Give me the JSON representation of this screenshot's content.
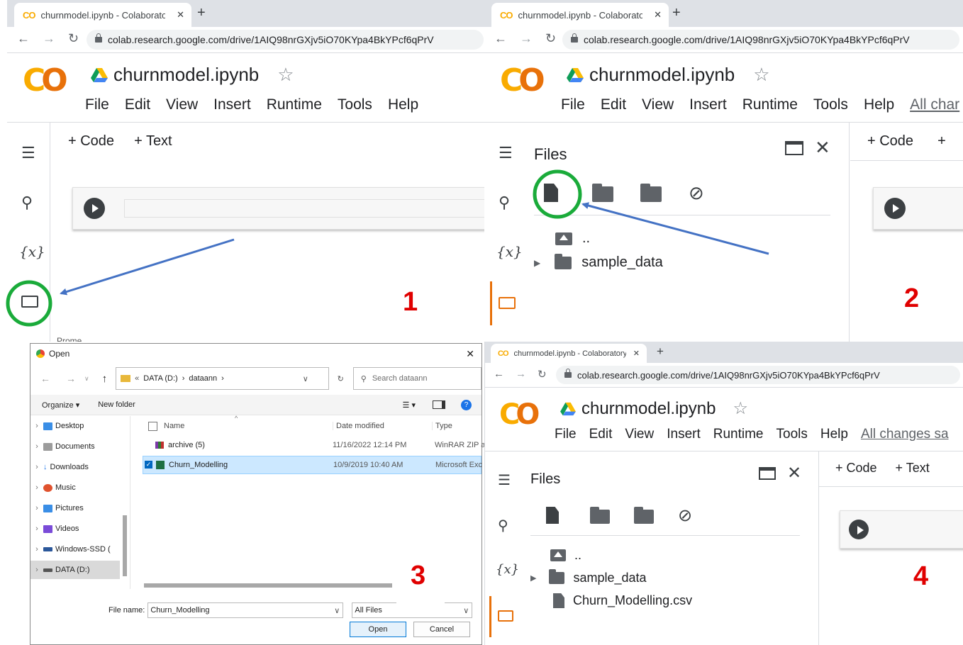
{
  "browser": {
    "tab_title": "churnmodel.ipynb - Colaboratory",
    "tab_logo": "CO",
    "tab_close": "✕",
    "new_tab": "+",
    "url": "colab.research.google.com/drive/1AIQ98nrGXjv5iO70KYpa4BkYPcf6qPrV",
    "nav_icons": [
      "back-icon",
      "forward-icon",
      "reload-icon"
    ]
  },
  "colab": {
    "logo_c": "C",
    "logo_o": "O",
    "notebook_title": "churnmodel.ipynb",
    "star": "☆",
    "menu": [
      "File",
      "Edit",
      "View",
      "Insert",
      "Runtime",
      "Tools",
      "Help"
    ],
    "all_changes_short": "All char",
    "all_changes_long": "All changes sa",
    "code_btn": "+ Code",
    "text_btn": "+ Text",
    "code_btn_short": "+ Code",
    "text_btn_short": "+",
    "files_title": "Files",
    "parent_dir": "..",
    "folder_name": "sample_data",
    "uploaded_file": "Churn_Modelling.csv",
    "partial_text": "Prome"
  },
  "steps": [
    "1",
    "2",
    "3",
    "4"
  ],
  "dialog": {
    "title": "Open",
    "path_prefix": "«",
    "path": [
      "DATA (D:)",
      "dataann"
    ],
    "search_placeholder": "Search dataann",
    "organize": "Organize",
    "new_folder": "New folder",
    "columns": [
      "Name",
      "Date modified",
      "Type"
    ],
    "rows": [
      {
        "name": "archive (5)",
        "date": "11/16/2022 12:14 PM",
        "type": "WinRAR ZIP a",
        "selected": false
      },
      {
        "name": "Churn_Modelling",
        "date": "10/9/2019 10:40 AM",
        "type": "Microsoft Exc",
        "selected": true
      }
    ],
    "nav": [
      "Desktop",
      "Documents",
      "Downloads",
      "Music",
      "Pictures",
      "Videos",
      "Windows-SSD (",
      "DATA (D:)"
    ],
    "file_name_label": "File name:",
    "file_name_value": "Churn_Modelling",
    "filter": "All Files",
    "open_btn": "Open",
    "cancel_btn": "Cancel"
  },
  "colors": {
    "annotation_green": "#1aab3a",
    "annotation_arrow": "#4472c4",
    "step_red": "#e00000",
    "colab_orange": "#e8710a",
    "colab_yellow": "#f9ab00"
  }
}
